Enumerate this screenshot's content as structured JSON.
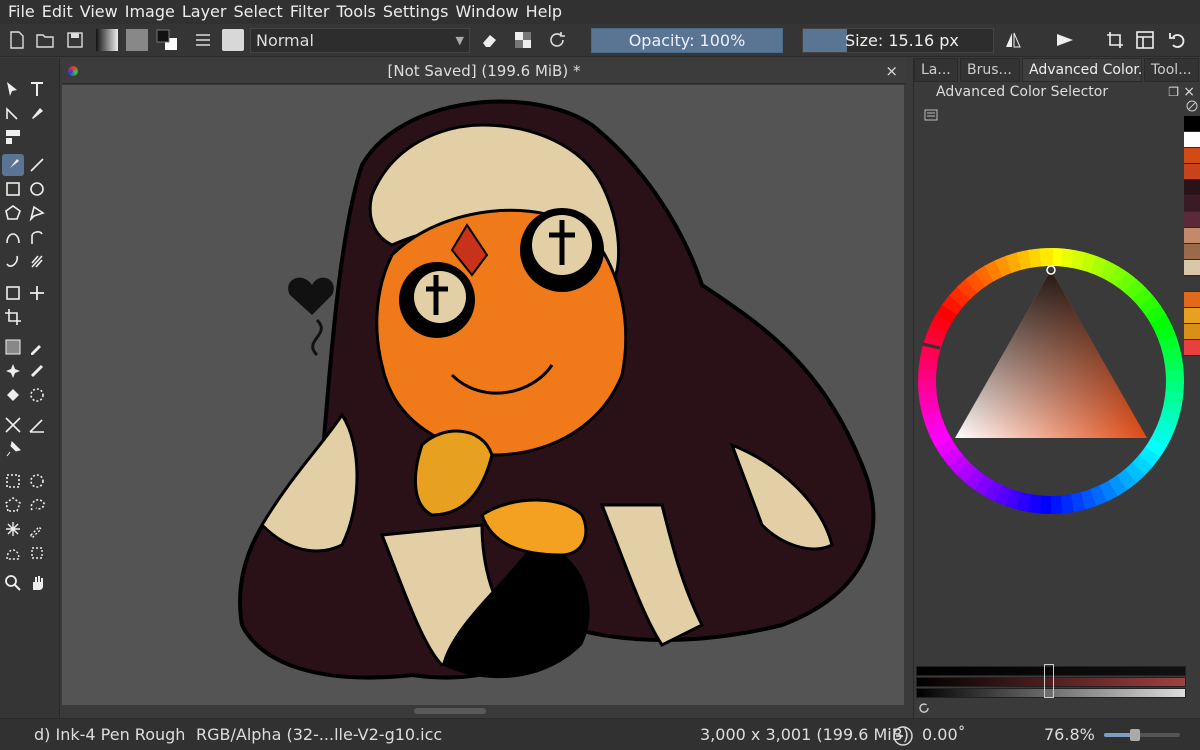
{
  "menubar": {
    "items": [
      "File",
      "Edit",
      "View",
      "Image",
      "Layer",
      "Select",
      "Filter",
      "Tools",
      "Settings",
      "Window",
      "Help"
    ]
  },
  "toolbar": {
    "blend_mode": "Normal",
    "opacity_label": "Opacity: 100%",
    "opacity": 1.0,
    "size_label": "Size: 15.16 px"
  },
  "document": {
    "tab_title": "[Not Saved]  (199.6 MiB) *",
    "close_glyph": "×"
  },
  "docker": {
    "tabs": [
      "La...",
      "Brus...",
      "Advanced Color...",
      "Tool..."
    ],
    "active_tab": 2,
    "title": "Advanced Color Selector",
    "palette": [
      "#000000",
      "#ffffff",
      "#d24a16",
      "#c8431a",
      "#2a1218",
      "#3a1a24",
      "#5a2a3a",
      "#c38a6a",
      "#9a6a4a",
      "#d8c8a8",
      "#3a3a3a",
      "#e06a1a",
      "#e8a020",
      "#d89018",
      "#e84040"
    ],
    "selected_hue_color": "#e24a14"
  },
  "statusbar": {
    "brush": "d) Ink-4 Pen Rough",
    "color_profile": "RGB/Alpha (32-...lle-V2-g10.icc",
    "dimensions": "3,000 x 3,001 (199.6 MiB)",
    "rotation": "0.00˚",
    "zoom": "76.8%"
  },
  "colors": {
    "accent": "#5a7593",
    "canvas_bg": "#545454",
    "robe": "#2a1118",
    "skin": "#f07a1a",
    "trim": "#e3cfa6"
  }
}
